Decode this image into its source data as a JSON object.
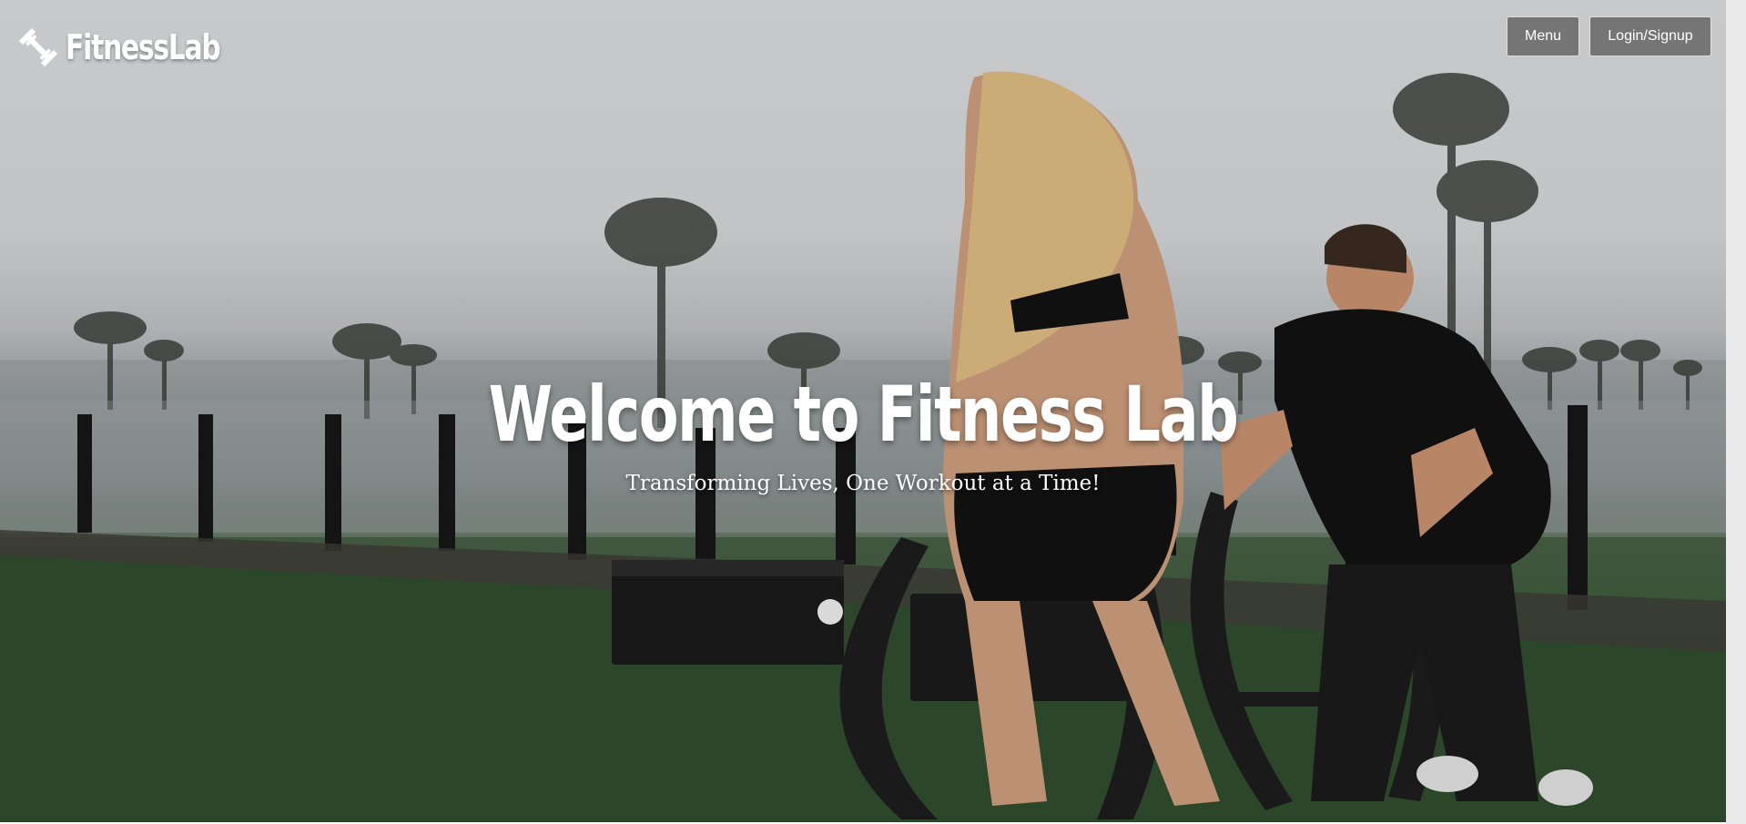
{
  "brand": {
    "name": "FitnessLab",
    "icon": "dumbbell-icon"
  },
  "nav": {
    "menu_label": "Menu",
    "login_label": "Login/Signup"
  },
  "hero": {
    "headline": "Welcome to Fitness Lab",
    "tagline": "Transforming Lives, One Workout at a Time!",
    "image": "photo-rooftop-sled-workout"
  },
  "colors": {
    "button_bg": "#757575",
    "button_text": "#ffffff",
    "text": "#ffffff"
  }
}
